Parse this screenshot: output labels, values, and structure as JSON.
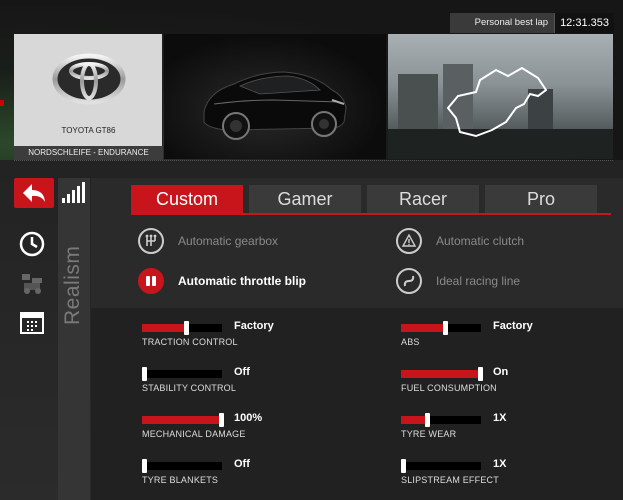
{
  "header": {
    "lap_label": "Personal best lap time",
    "lap_value": "12:31.353",
    "car_name": "TOYOTA GT86",
    "track_name": "NORDSCHLEIFE - ENDURANCE"
  },
  "sidebar": {
    "section_label": "Realism",
    "icons": [
      "back-arrow-icon",
      "clock-icon",
      "car-setup-icon",
      "calendar-icon",
      "signal-bars-icon"
    ]
  },
  "tabs": [
    {
      "label": "Custom",
      "active": true
    },
    {
      "label": "Gamer",
      "active": false
    },
    {
      "label": "Racer",
      "active": false
    },
    {
      "label": "Pro",
      "active": false
    }
  ],
  "assists": [
    {
      "label": "Automatic gearbox",
      "on": false,
      "icon": "gearbox-icon"
    },
    {
      "label": "Automatic clutch",
      "on": false,
      "icon": "clutch-warning-icon"
    },
    {
      "label": "Automatic throttle blip",
      "on": true,
      "icon": "throttle-pedal-icon"
    },
    {
      "label": "Ideal racing line",
      "on": false,
      "icon": "racing-line-icon"
    }
  ],
  "sliders": [
    {
      "name": "TRACTION CONTROL",
      "value": "Factory",
      "level": 0.55
    },
    {
      "name": "ABS",
      "value": "Factory",
      "level": 0.55
    },
    {
      "name": "STABILITY CONTROL",
      "value": "Off",
      "level": 0.0
    },
    {
      "name": "FUEL CONSUMPTION",
      "value": "On",
      "level": 1.0
    },
    {
      "name": "MECHANICAL DAMAGE",
      "value": "100%",
      "level": 1.0
    },
    {
      "name": "TYRE WEAR",
      "value": "1X",
      "level": 0.33
    },
    {
      "name": "TYRE BLANKETS",
      "value": "Off",
      "level": 0.0
    },
    {
      "name": "SLIPSTREAM EFFECT",
      "value": "1X",
      "level": 0.0
    }
  ],
  "colors": {
    "accent": "#c8141b"
  }
}
